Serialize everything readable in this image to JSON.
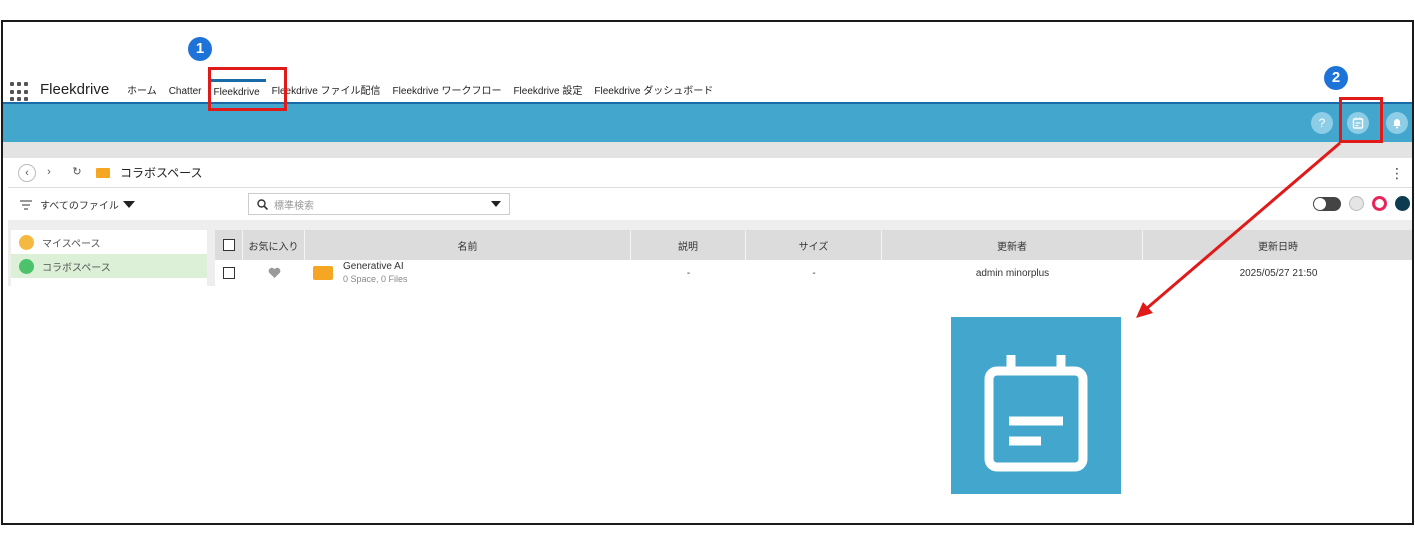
{
  "app": {
    "name": "Fleekdrive"
  },
  "nav": {
    "tabs": [
      {
        "label": "ホーム"
      },
      {
        "label": "Chatter"
      },
      {
        "label": "Fleekdrive"
      },
      {
        "label": "Fleekdrive ファイル配信"
      },
      {
        "label": "Fleekdrive ワークフロー"
      },
      {
        "label": "Fleekdrive 設定"
      },
      {
        "label": "Fleekdrive ダッシュボード"
      }
    ],
    "active_tab": "Fleekdrive"
  },
  "header": {
    "help_glyph": "?"
  },
  "path": {
    "folder": "コラボスペース",
    "menu_glyph": "⋮"
  },
  "filter": {
    "label": "すべてのファイル",
    "search_placeholder": "標準検索"
  },
  "sidebar": {
    "items": [
      {
        "label": "マイスペース"
      },
      {
        "label": "コラボスペース"
      }
    ]
  },
  "table": {
    "headers": [
      "お気に入り",
      "名前",
      "説明",
      "サイズ",
      "更新者",
      "更新日時"
    ],
    "rows": [
      {
        "name": "Generative AI",
        "sub": "0 Space, 0 Files",
        "description": "-",
        "size": "-",
        "updated_by": "admin minorplus",
        "updated_at": "2025/05/27 21:50"
      }
    ]
  },
  "annotations": {
    "badge1": "1",
    "badge2": "2"
  },
  "colors": {
    "header_bar": "#42a6cd",
    "active_tab": "#1b6aa8",
    "highlight": "#e01919",
    "badge": "#1e73d8",
    "folder": "#f5a623",
    "sidebar_selected": "#dcf0d8"
  }
}
